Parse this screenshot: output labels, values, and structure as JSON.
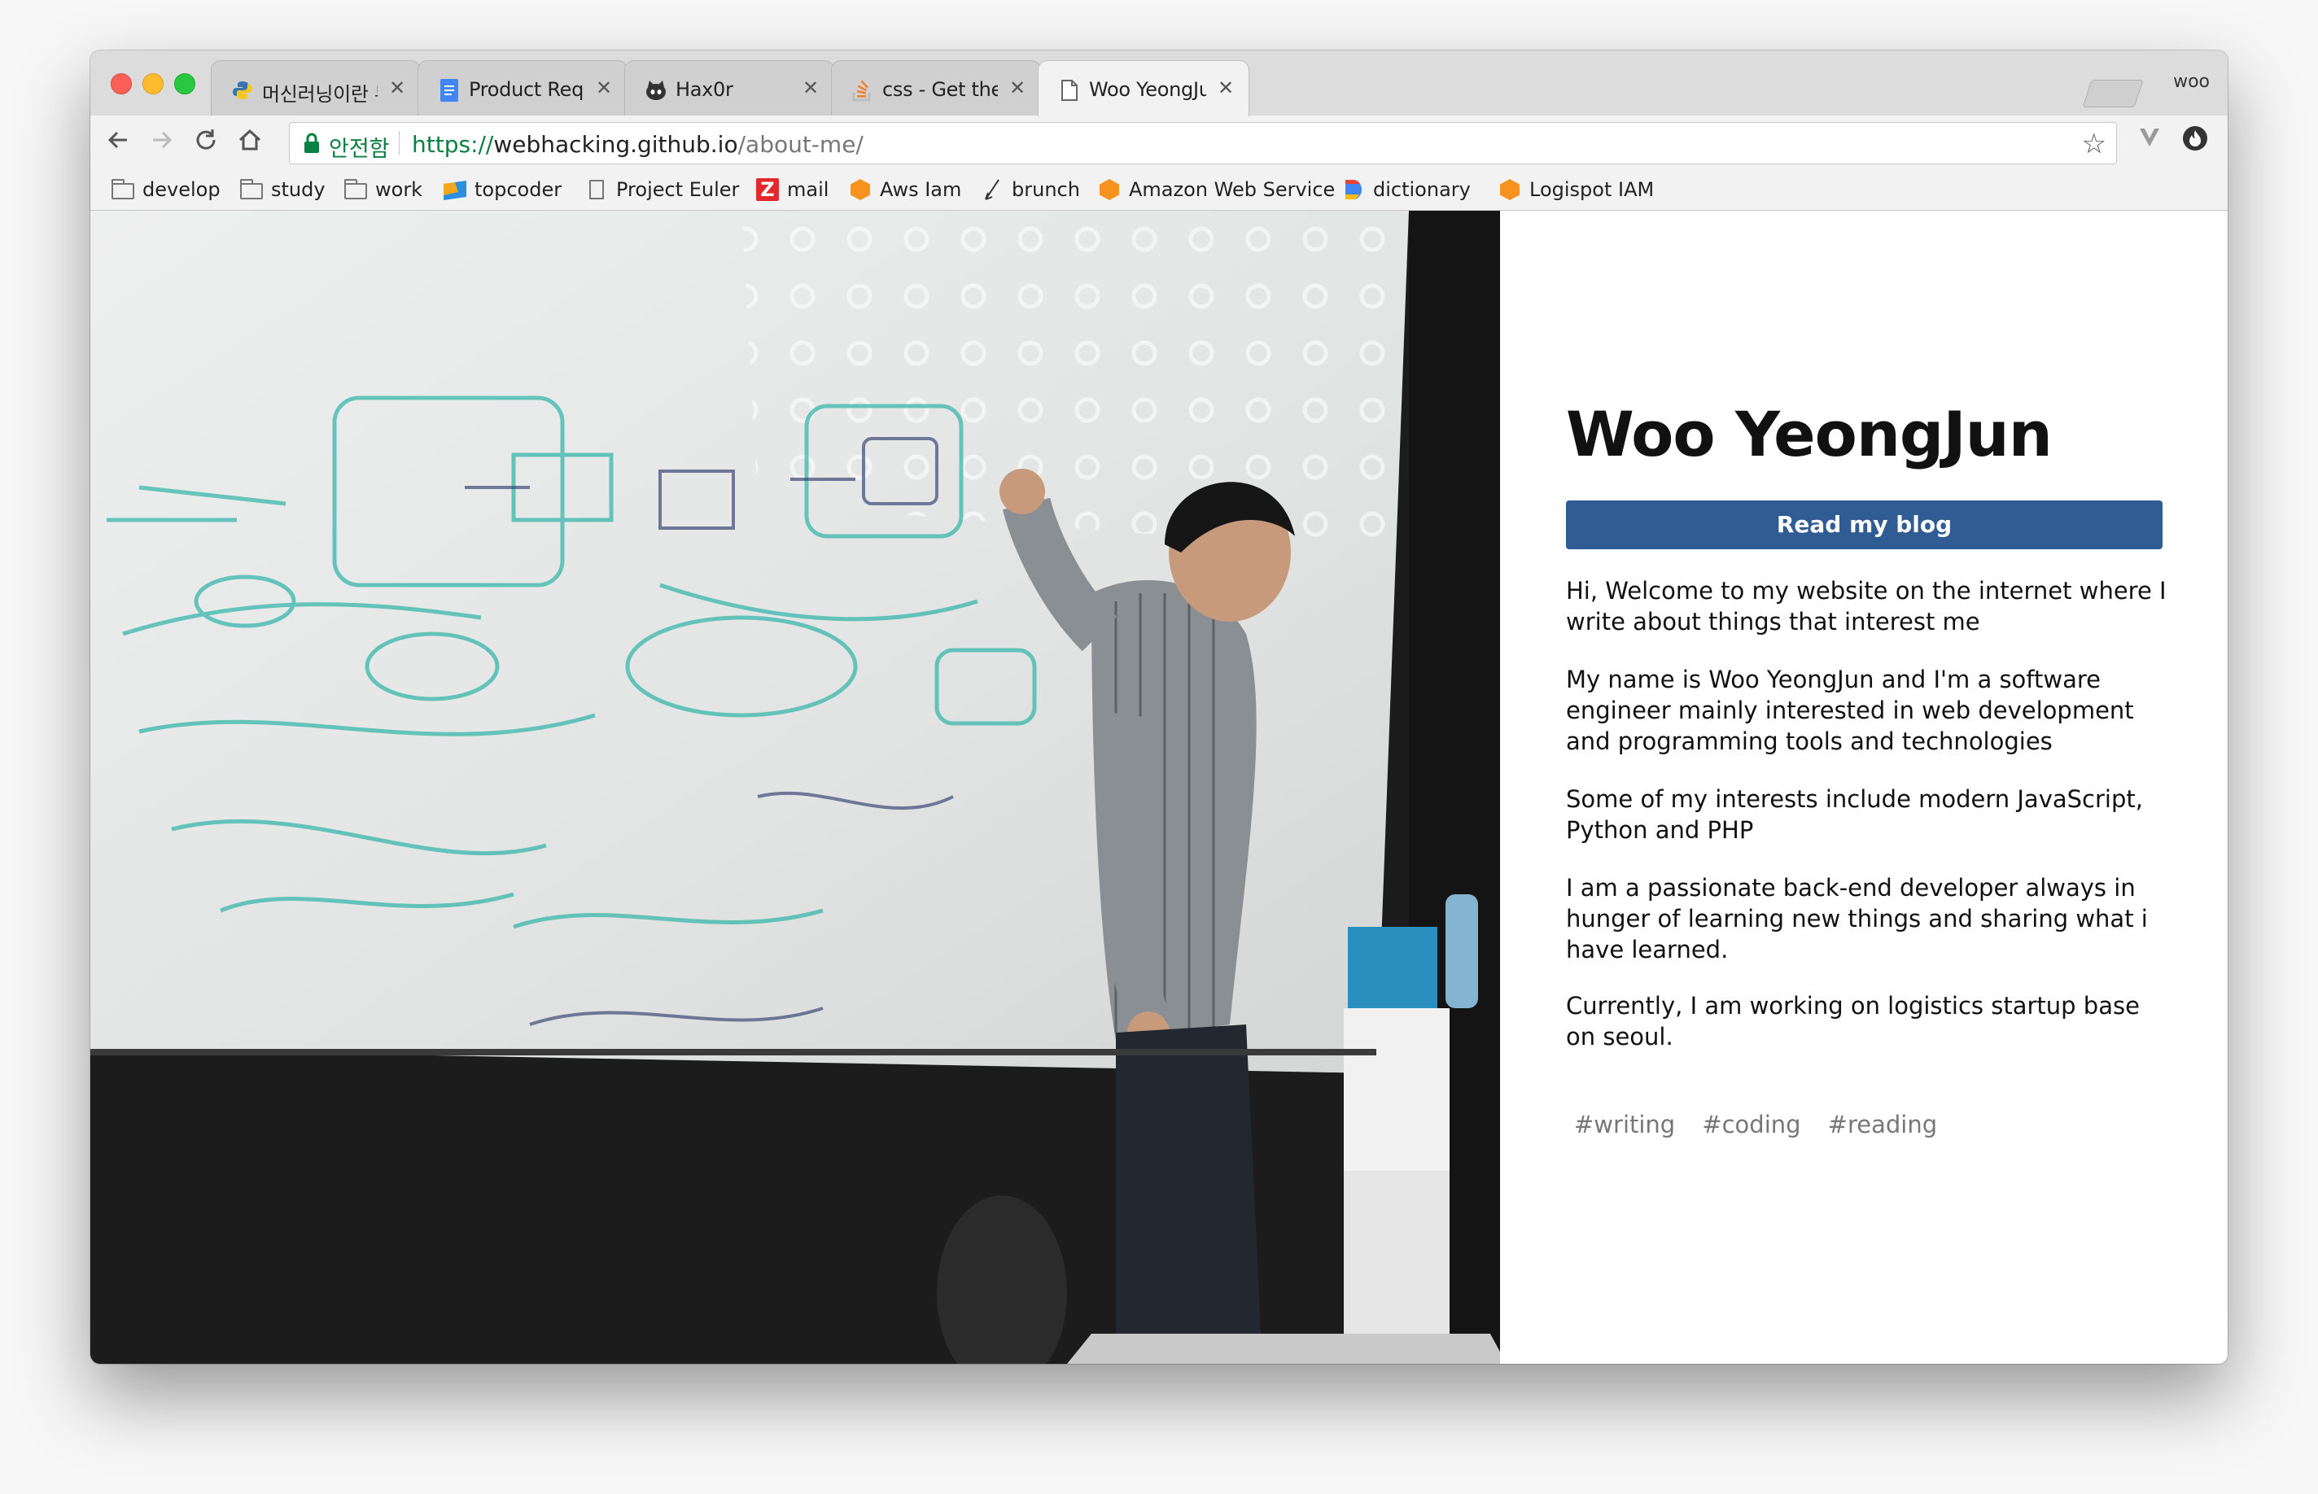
{
  "browser": {
    "tabs": [
      {
        "title": "머신러닝이란 무엇인가? - Kilho Kim",
        "favicon": "python-icon"
      },
      {
        "title": "Product Requirement Document",
        "favicon": "google-docs-icon"
      },
      {
        "title": "Hax0r",
        "favicon": "octocat-icon"
      },
      {
        "title": "css - Get the device width in javascript",
        "favicon": "stackoverflow-icon"
      },
      {
        "title": "Woo YeongJun",
        "favicon": "page-icon"
      }
    ],
    "active_tab": 4,
    "profile_name": "woo",
    "secure_label": "안전함",
    "url_scheme": "https://",
    "url_host": "webhacking.github.io",
    "url_path": "/about-me/",
    "bookmarks": [
      {
        "label": "develop",
        "icon": "folder-icon"
      },
      {
        "label": "study",
        "icon": "folder-icon"
      },
      {
        "label": "work",
        "icon": "folder-icon"
      },
      {
        "label": "topcoder",
        "icon": "topcoder-icon"
      },
      {
        "label": "Project Euler",
        "icon": "page-icon"
      },
      {
        "label": "mail",
        "icon": "zmail-icon"
      },
      {
        "label": "Aws Iam",
        "icon": "aws-icon"
      },
      {
        "label": "brunch",
        "icon": "brunch-icon"
      },
      {
        "label": "Amazon Web Services",
        "icon": "aws-icon"
      },
      {
        "label": "dictionary",
        "icon": "dictionary-icon"
      },
      {
        "label": "Logispot IAM",
        "icon": "aws-icon"
      }
    ]
  },
  "page": {
    "name": "Woo YeongJun",
    "blog_button": "Read my blog",
    "paragraphs": [
      "Hi, Welcome to my website on the internet where I write about things that interest me",
      "My name is Woo YeongJun and I'm a software engineer mainly interested in web development and programming tools and technologies",
      "Some of my interests include modern JavaScript, Python and PHP",
      "I am a passionate back-end developer always in hunger of learning new things and sharing what i have learned.",
      "Currently, I am working on logistics startup base on seoul."
    ],
    "tags": [
      "#writing",
      "#coding",
      "#reading"
    ],
    "photo_alt": "Person writing on a whiteboard",
    "accent_color": "#2f5c92"
  }
}
